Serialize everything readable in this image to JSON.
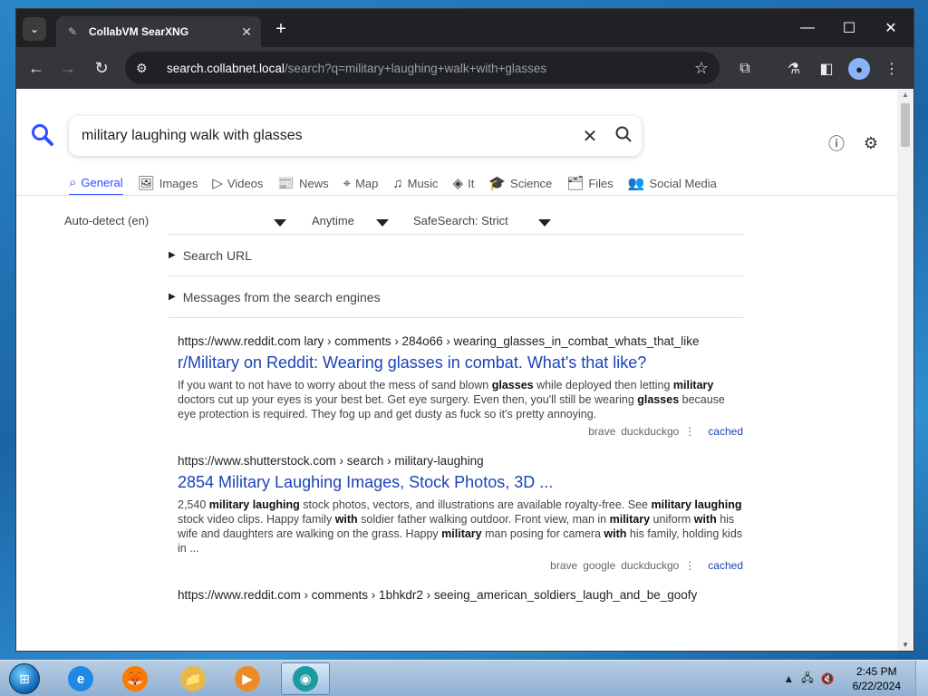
{
  "browser": {
    "tab_title": "CollabVM SearXNG",
    "url_host": "search.collabnet.local",
    "url_path": "/search?q=military+laughing+walk+with+glasses"
  },
  "page": {
    "query": "military laughing walk with glasses",
    "categories": [
      {
        "label": "General",
        "icon": "search-icon",
        "active": true
      },
      {
        "label": "Images",
        "icon": "image-icon"
      },
      {
        "label": "Videos",
        "icon": "play-icon"
      },
      {
        "label": "News",
        "icon": "newspaper-icon"
      },
      {
        "label": "Map",
        "icon": "map-pin-icon"
      },
      {
        "label": "Music",
        "icon": "music-icon"
      },
      {
        "label": "It",
        "icon": "layers-icon"
      },
      {
        "label": "Science",
        "icon": "graduation-cap-icon"
      },
      {
        "label": "Files",
        "icon": "files-icon"
      },
      {
        "label": "Social Media",
        "icon": "people-icon"
      }
    ],
    "filters": {
      "language": "Auto-detect (en)",
      "time": "Anytime",
      "safesearch": "SafeSearch: Strict"
    },
    "details": [
      "Search URL",
      "Messages from the search engines"
    ],
    "results": [
      {
        "url": "https://www.reddit.com  lary › comments › 284o66 › wearing_glasses_in_combat_whats_that_like",
        "title": "r/Military on Reddit: Wearing glasses in combat. What's that like?",
        "snippet_html": "If you want to not have to worry about the mess of sand blown <b>glasses</b> while deployed then letting <b>military</b> doctors cut up your eyes is your best bet. Get eye surgery. Even then, you'll still be wearing <b>glasses</b> because eye protection is required. They fog up and get dusty as fuck so it's pretty annoying.",
        "engines": [
          "brave",
          "duckduckgo"
        ],
        "cached": "cached"
      },
      {
        "url": "https://www.shutterstock.com  › search › military-laughing",
        "title": "2854 Military Laughing Images, Stock Photos, 3D ...",
        "snippet_html": "2,540 <b>military laughing</b> stock photos, vectors, and illustrations are available royalty-free. See <b>military laughing</b> stock video clips. Happy family <b>with</b> soldier father walking outdoor. Front view, man in <b>military</b> uniform <b>with</b> his wife and daughters are walking on the grass. Happy <b>military</b> man posing for camera <b>with</b> his family, holding kids in ...",
        "engines": [
          "brave",
          "google",
          "duckduckgo"
        ],
        "cached": "cached"
      },
      {
        "url": "https://www.reddit.com   › comments › 1bhkdr2 › seeing_american_soldiers_laugh_and_be_goofy",
        "title": "",
        "snippet_html": "",
        "engines": [],
        "cached": ""
      }
    ]
  },
  "taskbar": {
    "apps": [
      {
        "name": "internet-explorer",
        "glyph": "e",
        "color": "#1e88e5"
      },
      {
        "name": "firefox",
        "glyph": "🦊",
        "color": "#ff7a00"
      },
      {
        "name": "explorer",
        "glyph": "📁",
        "color": "#e8b94a"
      },
      {
        "name": "media-player",
        "glyph": "▶",
        "color": "#f08a24"
      },
      {
        "name": "edge-chromium",
        "glyph": "◉",
        "color": "#1b9aa0",
        "active": true
      }
    ],
    "time": "2:45 PM",
    "date": "6/22/2024"
  }
}
